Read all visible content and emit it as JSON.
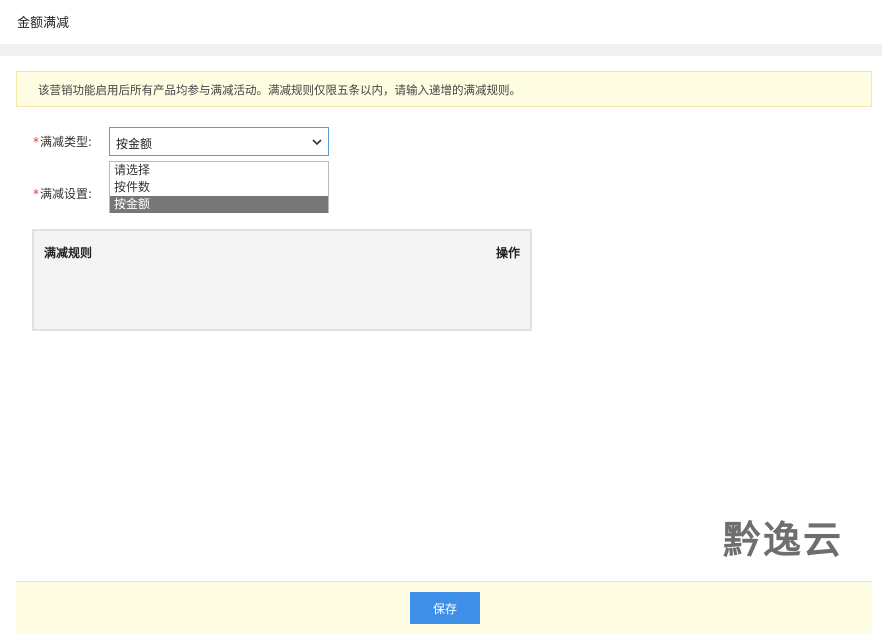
{
  "header": {
    "title": "金额满减"
  },
  "notice": {
    "text": "该营销功能启用后所有产品均参与满减活动。满减规则仅限五条以内，请输入递增的满减规则。"
  },
  "form": {
    "type_label": "满减类型:",
    "setting_label": "满减设置:",
    "required_mark": "*",
    "type_select": {
      "value": "按金额",
      "options": [
        "请选择",
        "按件数",
        "按金额"
      ],
      "selected_index": 2
    }
  },
  "rules_table": {
    "headers": {
      "rule": "满减规则",
      "action": "操作"
    }
  },
  "footer": {
    "save_label": "保存"
  },
  "watermark": {
    "text": "黔逸云"
  },
  "colors": {
    "accent": "#3d8fe8",
    "notice_bg": "#fefde1",
    "required": "#e23c3c",
    "selected_option_bg": "#777777"
  }
}
